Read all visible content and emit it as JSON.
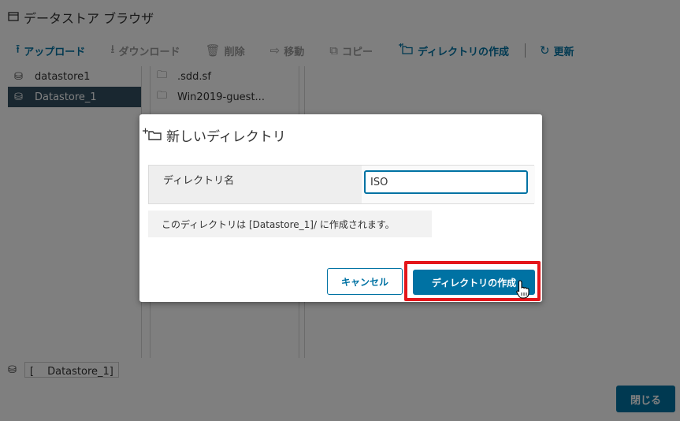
{
  "window": {
    "title": "データストア ブラウザ",
    "title_icon": "datastore-browser-icon"
  },
  "toolbar": {
    "upload": "アップロード",
    "download": "ダウンロード",
    "delete": "削除",
    "move": "移動",
    "copy": "コピー",
    "mkdir": "ディレクトリの作成",
    "refresh": "更新"
  },
  "pane1": {
    "items": [
      {
        "label": "datastore1"
      },
      {
        "label": "Datastore_1"
      }
    ]
  },
  "pane2": {
    "items": [
      {
        "label": ".sdd.sf"
      },
      {
        "label": "Win2019-guest..."
      }
    ]
  },
  "breadcrumb": {
    "text": "[　 Datastore_1]"
  },
  "close_label": "閉じる",
  "dialog": {
    "title": "新しいディレクトリ",
    "field_label": "ディレクトリ名",
    "field_value": "ISO",
    "note": "このディレクトリは [Datastore_1]/ に作成されます。",
    "cancel_label": "キャンセル",
    "create_label": "ディレクトリの作成"
  },
  "colors": {
    "primary": "#0072a3",
    "highlight": "#e4161b",
    "selected_row": "#324f61"
  }
}
